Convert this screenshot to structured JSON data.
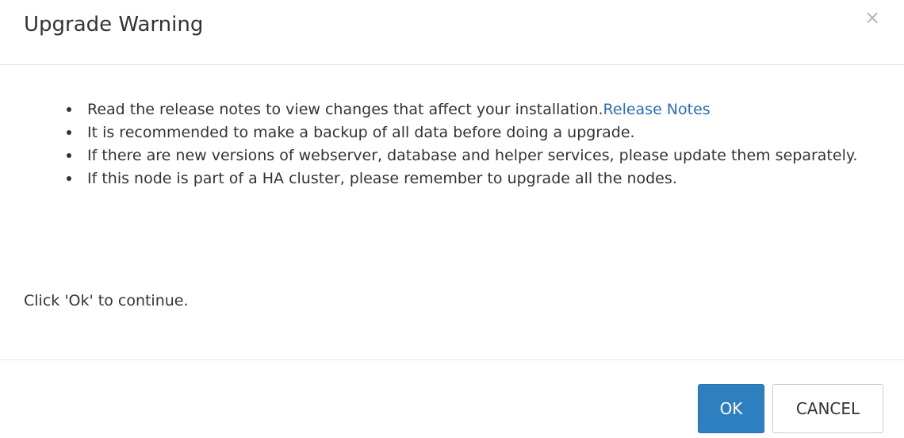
{
  "dialog": {
    "title": "Upgrade Warning",
    "close_glyph": "×"
  },
  "body": {
    "notes": [
      {
        "text": "Read the release notes to view changes that affect your installation.",
        "link_text": "Release Notes"
      },
      {
        "text": "It is recommended to make a backup of all data before doing a upgrade."
      },
      {
        "text": "If there are new versions of webserver, database and helper services, please update them separately."
      },
      {
        "text": "If this node is part of a HA cluster, please remember to upgrade all the nodes."
      }
    ],
    "continue_text": "Click 'Ok' to continue."
  },
  "footer": {
    "ok_label": "OK",
    "cancel_label": "CANCEL"
  },
  "colors": {
    "primary_button": "#2e7fc0",
    "link": "#2a6ebb"
  },
  "icons": {
    "close": "close-icon"
  }
}
